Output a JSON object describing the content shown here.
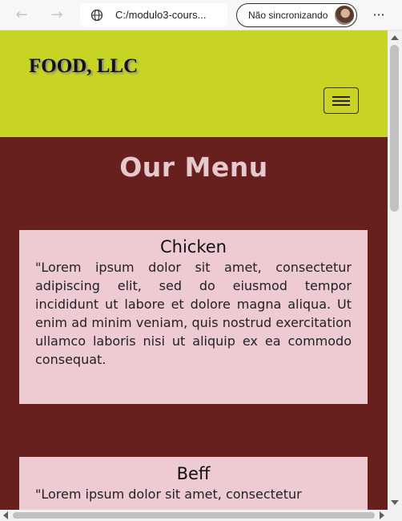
{
  "browser": {
    "back_icon": "back-arrow-icon",
    "forward_icon": "forward-arrow-icon",
    "address_icon": "globe-icon",
    "address_text": "C:/modulo3-cours...",
    "sync_label": "Não sincronizando",
    "more_icon": "more-horizontal-icon",
    "more_glyph": "···"
  },
  "site": {
    "brand": "FOOD, LLC",
    "menu_toggle_icon": "hamburger-menu-icon",
    "header_color": "#c8d424",
    "background_color": "#68201f",
    "card_color": "#eecad2"
  },
  "page": {
    "heading": "Our Menu",
    "sections": [
      {
        "title": "Chicken",
        "body": "\"Lorem ipsum dolor sit amet, consectetur adipiscing elit, sed do eiusmod tempor incididunt ut labore et dolore magna aliqua. Ut enim ad minim veniam, quis nostrud exercitation ullamco laboris nisi ut aliquip ex ea commodo consequat."
      },
      {
        "title": "Beff",
        "body": "\"Lorem ipsum dolor sit amet, consectetur"
      }
    ]
  }
}
